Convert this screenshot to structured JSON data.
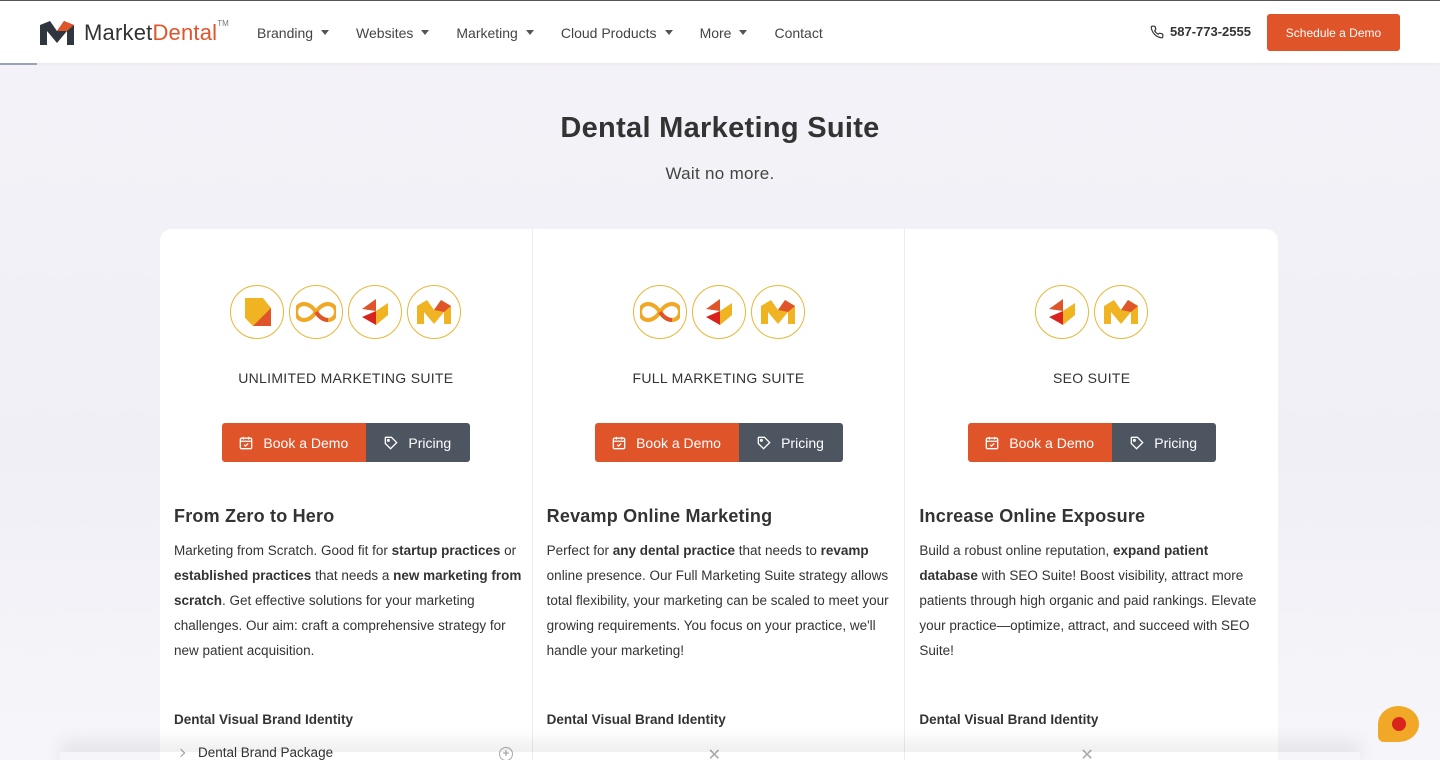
{
  "header": {
    "logo_text_a": "Market",
    "logo_text_b": "Dental",
    "logo_tm": "TM",
    "nav": [
      {
        "label": "Branding"
      },
      {
        "label": "Websites"
      },
      {
        "label": "Marketing"
      },
      {
        "label": "Cloud Products"
      },
      {
        "label": "More"
      },
      {
        "label": "Contact"
      }
    ],
    "phone": "587-773-2555",
    "cta_label": "Schedule a Demo"
  },
  "hero": {
    "title": "Dental Marketing Suite",
    "subtitle": "Wait no more."
  },
  "plans": [
    {
      "name": "UNLIMITED MARKETING SUITE",
      "demo_label": "Book a Demo",
      "pricing_label": "Pricing",
      "heading": "From Zero to Hero",
      "desc": [
        {
          "t": "Marketing from Scratch. Good fit for ",
          "b": false
        },
        {
          "t": "startup practices",
          "b": true
        },
        {
          "t": " or ",
          "b": false
        },
        {
          "t": "established practices",
          "b": true
        },
        {
          "t": " that needs a ",
          "b": false
        },
        {
          "t": "new marketing from scratch",
          "b": true
        },
        {
          "t": ". Get effective solutions for your marketing challenges. Our aim: craft a comprehensive strategy for new patient acquisition.",
          "b": false
        }
      ],
      "feature_heading": "Dental Visual Brand Identity",
      "feature_item": "Dental Brand Package",
      "feature_plus": "+"
    },
    {
      "name": "FULL MARKETING SUITE",
      "demo_label": "Book a Demo",
      "pricing_label": "Pricing",
      "heading": "Revamp Online Marketing",
      "desc": [
        {
          "t": "Perfect for ",
          "b": false
        },
        {
          "t": "any dental practice",
          "b": true
        },
        {
          "t": " that needs to ",
          "b": false
        },
        {
          "t": "revamp",
          "b": true
        },
        {
          "t": " online presence. Our Full Marketing Suite strategy allows total flexibility, your marketing can be scaled to meet your growing requirements. You focus on your practice, we'll handle your marketing!",
          "b": false
        }
      ],
      "feature_heading": "Dental Visual Brand Identity",
      "feature_mark": "✕"
    },
    {
      "name": "SEO SUITE",
      "demo_label": "Book a Demo",
      "pricing_label": "Pricing",
      "heading": "Increase Online Exposure",
      "desc": [
        {
          "t": "Build a robust online reputation, ",
          "b": false
        },
        {
          "t": "expand patient database",
          "b": true
        },
        {
          "t": " with SEO Suite! Boost visibility, attract more patients through high organic and paid rankings. Elevate your practice—optimize, attract, and succeed with SEO Suite!",
          "b": false
        }
      ],
      "feature_heading": "Dental Visual Brand Identity",
      "feature_mark": "✕"
    }
  ],
  "colors": {
    "accent": "#e0542a",
    "dark_button": "#4d5561",
    "icon_ring": "#e8b73a",
    "chat": "#f0a826"
  }
}
